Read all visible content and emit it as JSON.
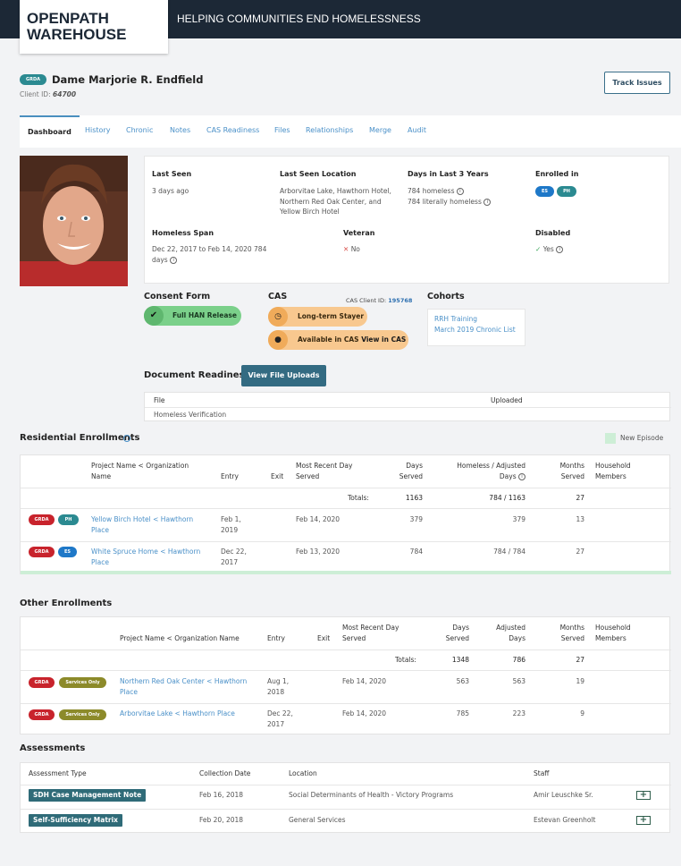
{
  "header": {
    "logo_line1": "OPENPATH",
    "logo_line2": "WAREHOUSE",
    "tagline": "HELPING COMMUNITIES END HOMELESSNESS"
  },
  "client": {
    "badge": "GRDA",
    "name": "Dame Marjorie R. Endfield",
    "id_label": "Client ID:",
    "id_value": "64700",
    "track_button": "Track Issues"
  },
  "tabs": [
    "Dashboard",
    "History",
    "Chronic",
    "Notes",
    "CAS Readiness",
    "Files",
    "Relationships",
    "Merge",
    "Audit"
  ],
  "summary": {
    "last_seen_label": "Last Seen",
    "last_seen": "3 days ago",
    "last_seen_location_label": "Last Seen Location",
    "last_seen_location": [
      "Arborvitae Lake, Hawthorn Hotel,",
      "Northern Red Oak Center, and",
      "Yellow Birch Hotel"
    ],
    "days_label": "Days in Last 3 Years",
    "days_homeless": "784 homeless",
    "days_literally": "784 literally homeless",
    "enrolled_label": "Enrolled in",
    "enrolled_es": "ES",
    "enrolled_ph": "PH",
    "span_label": "Homeless Span",
    "span_line1": "Dec 22, 2017 to Feb 14, 2020 784",
    "span_line2": "days",
    "veteran_label": "Veteran",
    "veteran": "No",
    "disabled_label": "Disabled",
    "disabled": "Yes"
  },
  "consent": {
    "title": "Consent Form",
    "status": "Full HAN Release"
  },
  "cas": {
    "title": "CAS",
    "client_id_label": "CAS Client ID:",
    "client_id": "195768",
    "tag1": "Long-term Stayer",
    "tag2_prefix": "Available in CAS",
    "tag2_link": "View in CAS"
  },
  "cohorts": {
    "title": "Cohorts",
    "items": [
      "RRH Training",
      "March 2019 Chronic List"
    ]
  },
  "documents": {
    "title": "Document Readiness",
    "button": "View File Uploads",
    "col_file": "File",
    "col_uploaded": "Uploaded",
    "row": "Homeless Verification"
  },
  "residential": {
    "title": "Residential Enrollments",
    "legend": "New Episode",
    "headers": {
      "project": [
        "Project Name < Organization",
        "Name"
      ],
      "entry": "Entry",
      "exit": "Exit",
      "recent": [
        "Most Recent Day",
        "Served"
      ],
      "days": [
        "Days",
        "Served"
      ],
      "homeless": [
        "Homeless / Adjusted",
        "Days"
      ],
      "months": [
        "Months",
        "Served"
      ],
      "household": [
        "Household",
        "Members"
      ]
    },
    "totals": {
      "label": "Totals:",
      "days": "1163",
      "homeless": "784 / 1163",
      "months": "27"
    },
    "rows": [
      {
        "badge1": "GRDA",
        "badge2": "PH",
        "project": [
          "Yellow Birch Hotel < Hawthorn",
          "Place"
        ],
        "entry": [
          "Feb 1,",
          "2019"
        ],
        "recent": "Feb 14, 2020",
        "days": "379",
        "homeless": "379",
        "months": "13"
      },
      {
        "badge1": "GRDA",
        "badge2": "ES",
        "project": [
          "White Spruce Home < Hawthorn",
          "Place"
        ],
        "entry": [
          "Dec 22,",
          "2017"
        ],
        "recent": "Feb 13, 2020",
        "days": "784",
        "homeless": "784 / 784",
        "months": "27"
      }
    ]
  },
  "other": {
    "title": "Other Enrollments",
    "headers": {
      "project": "Project Name < Organization Name",
      "entry": "Entry",
      "exit": "Exit",
      "recent": [
        "Most Recent Day",
        "Served"
      ],
      "days": [
        "Days",
        "Served"
      ],
      "adjusted": [
        "Adjusted",
        "Days"
      ],
      "months": [
        "Months",
        "Served"
      ],
      "household": [
        "Household",
        "Members"
      ]
    },
    "totals": {
      "label": "Totals:",
      "days": "1348",
      "adjusted": "786",
      "months": "27"
    },
    "rows": [
      {
        "badge1": "GRDA",
        "badge2": "Services Only",
        "project": [
          "Northern Red Oak Center < Hawthorn",
          "Place"
        ],
        "entry": [
          "Aug 1,",
          "2018"
        ],
        "recent": "Feb 14, 2020",
        "days": "563",
        "adjusted": "563",
        "months": "19"
      },
      {
        "badge1": "GRDA",
        "badge2": "Services Only",
        "project": [
          "Arborvitae Lake < Hawthorn Place",
          ""
        ],
        "entry": [
          "Dec 22,",
          "2017"
        ],
        "recent": "Feb 14, 2020",
        "days": "785",
        "adjusted": "223",
        "months": "9"
      }
    ]
  },
  "assessments": {
    "title": "Assessments",
    "headers": {
      "type": "Assessment Type",
      "date": "Collection Date",
      "location": "Location",
      "staff": "Staff"
    },
    "rows": [
      {
        "type": "SDH Case Management Note",
        "date": "Feb 16, 2018",
        "location": "Social Determinants of Health - Victory Programs",
        "staff": "Amir Leuschke Sr."
      },
      {
        "type": "Self-Sufficiency Matrix",
        "date": "Feb 20, 2018",
        "location": "General Services",
        "staff": "Estevan Greenholt"
      }
    ]
  },
  "colors": {
    "topbar": "#1c2836",
    "accent_link": "#4a90c8",
    "grda_red": "#c8232c",
    "teal_badge": "#2b8a91",
    "es_blue": "#1e78c8",
    "services_olive": "#8c8a2a",
    "consent_green": "#7bd08a",
    "cas_orange": "#f8c88f"
  }
}
